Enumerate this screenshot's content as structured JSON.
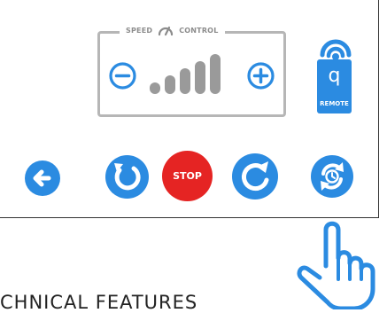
{
  "control_panel": {
    "speed_control": {
      "title_left": "SPEED",
      "title_right": "CONTROL",
      "current_level": 5,
      "max_level": 5
    },
    "remote": {
      "letter": "q",
      "label": "REMOTE"
    },
    "buttons": {
      "back": "left-arrow-icon",
      "rotate_left": "rotate-left-icon",
      "stop": "STOP",
      "rotate_right": "rotate-right-icon",
      "timer_cycle": "timer-cycle-icon"
    }
  },
  "caption": "CHNICAL FEATURES",
  "colors": {
    "blue": "#2b8be1",
    "red": "#e52423",
    "gray": "#9a9a9a"
  }
}
